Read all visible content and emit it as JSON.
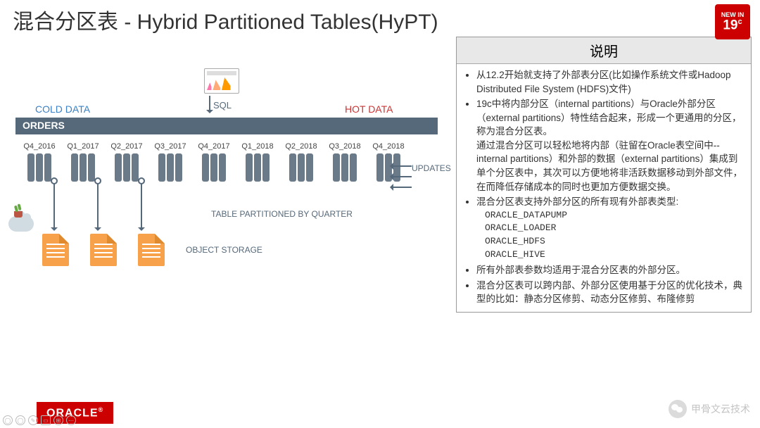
{
  "title": "混合分区表  - Hybrid Partitioned Tables(HyPT)",
  "badge": {
    "new_in": "NEW IN",
    "version": "19",
    "suffix": "c"
  },
  "diagram": {
    "cold": "COLD DATA",
    "hot": "HOT DATA",
    "sql": "SQL",
    "table_bar": "ORDERS",
    "partitions": [
      "Q4_2016",
      "Q1_2017",
      "Q2_2017",
      "Q3_2017",
      "Q4_2017",
      "Q1_2018",
      "Q2_2018",
      "Q3_2018",
      "Q4_2018"
    ],
    "updates": "UPDATES",
    "tp_label": "TABLE PARTITIONED BY QUARTER",
    "object_storage": "OBJECT STORAGE"
  },
  "explain": {
    "header": "说明",
    "b1": "从12.2开始就支持了外部表分区(比如操作系统文件或Hadoop Distributed File System (HDFS)文件)",
    "b2": "19c中将内部分区（internal partitions）与Oracle外部分区（external partitions）特性结合起来，形成一个更通用的分区，称为混合分区表。",
    "b2b": "通过混合分区可以轻松地将内部（驻留在Oracle表空间中--internal partitions）和外部的数据（external partitions）集成到单个分区表中，其次可以方便地将非活跃数据移动到外部文件，在而降低存储成本的同时也更加方便数据交换。",
    "b3": "混合分区表支持外部分区的所有现有外部表类型:",
    "types": [
      "ORACLE_DATAPUMP",
      "ORACLE_LOADER",
      "ORACLE_HDFS",
      "ORACLE_HIVE"
    ],
    "b4": "所有外部表参数均适用于混合分区表的外部分区。",
    "b5": "混合分区表可以跨内部、外部分区使用基于分区的优化技术，典型的比如：静态分区修剪、动态分区修剪、布隆修剪"
  },
  "footer": {
    "oracle": "ORACLE",
    "wechat": "甲骨文云技术"
  }
}
